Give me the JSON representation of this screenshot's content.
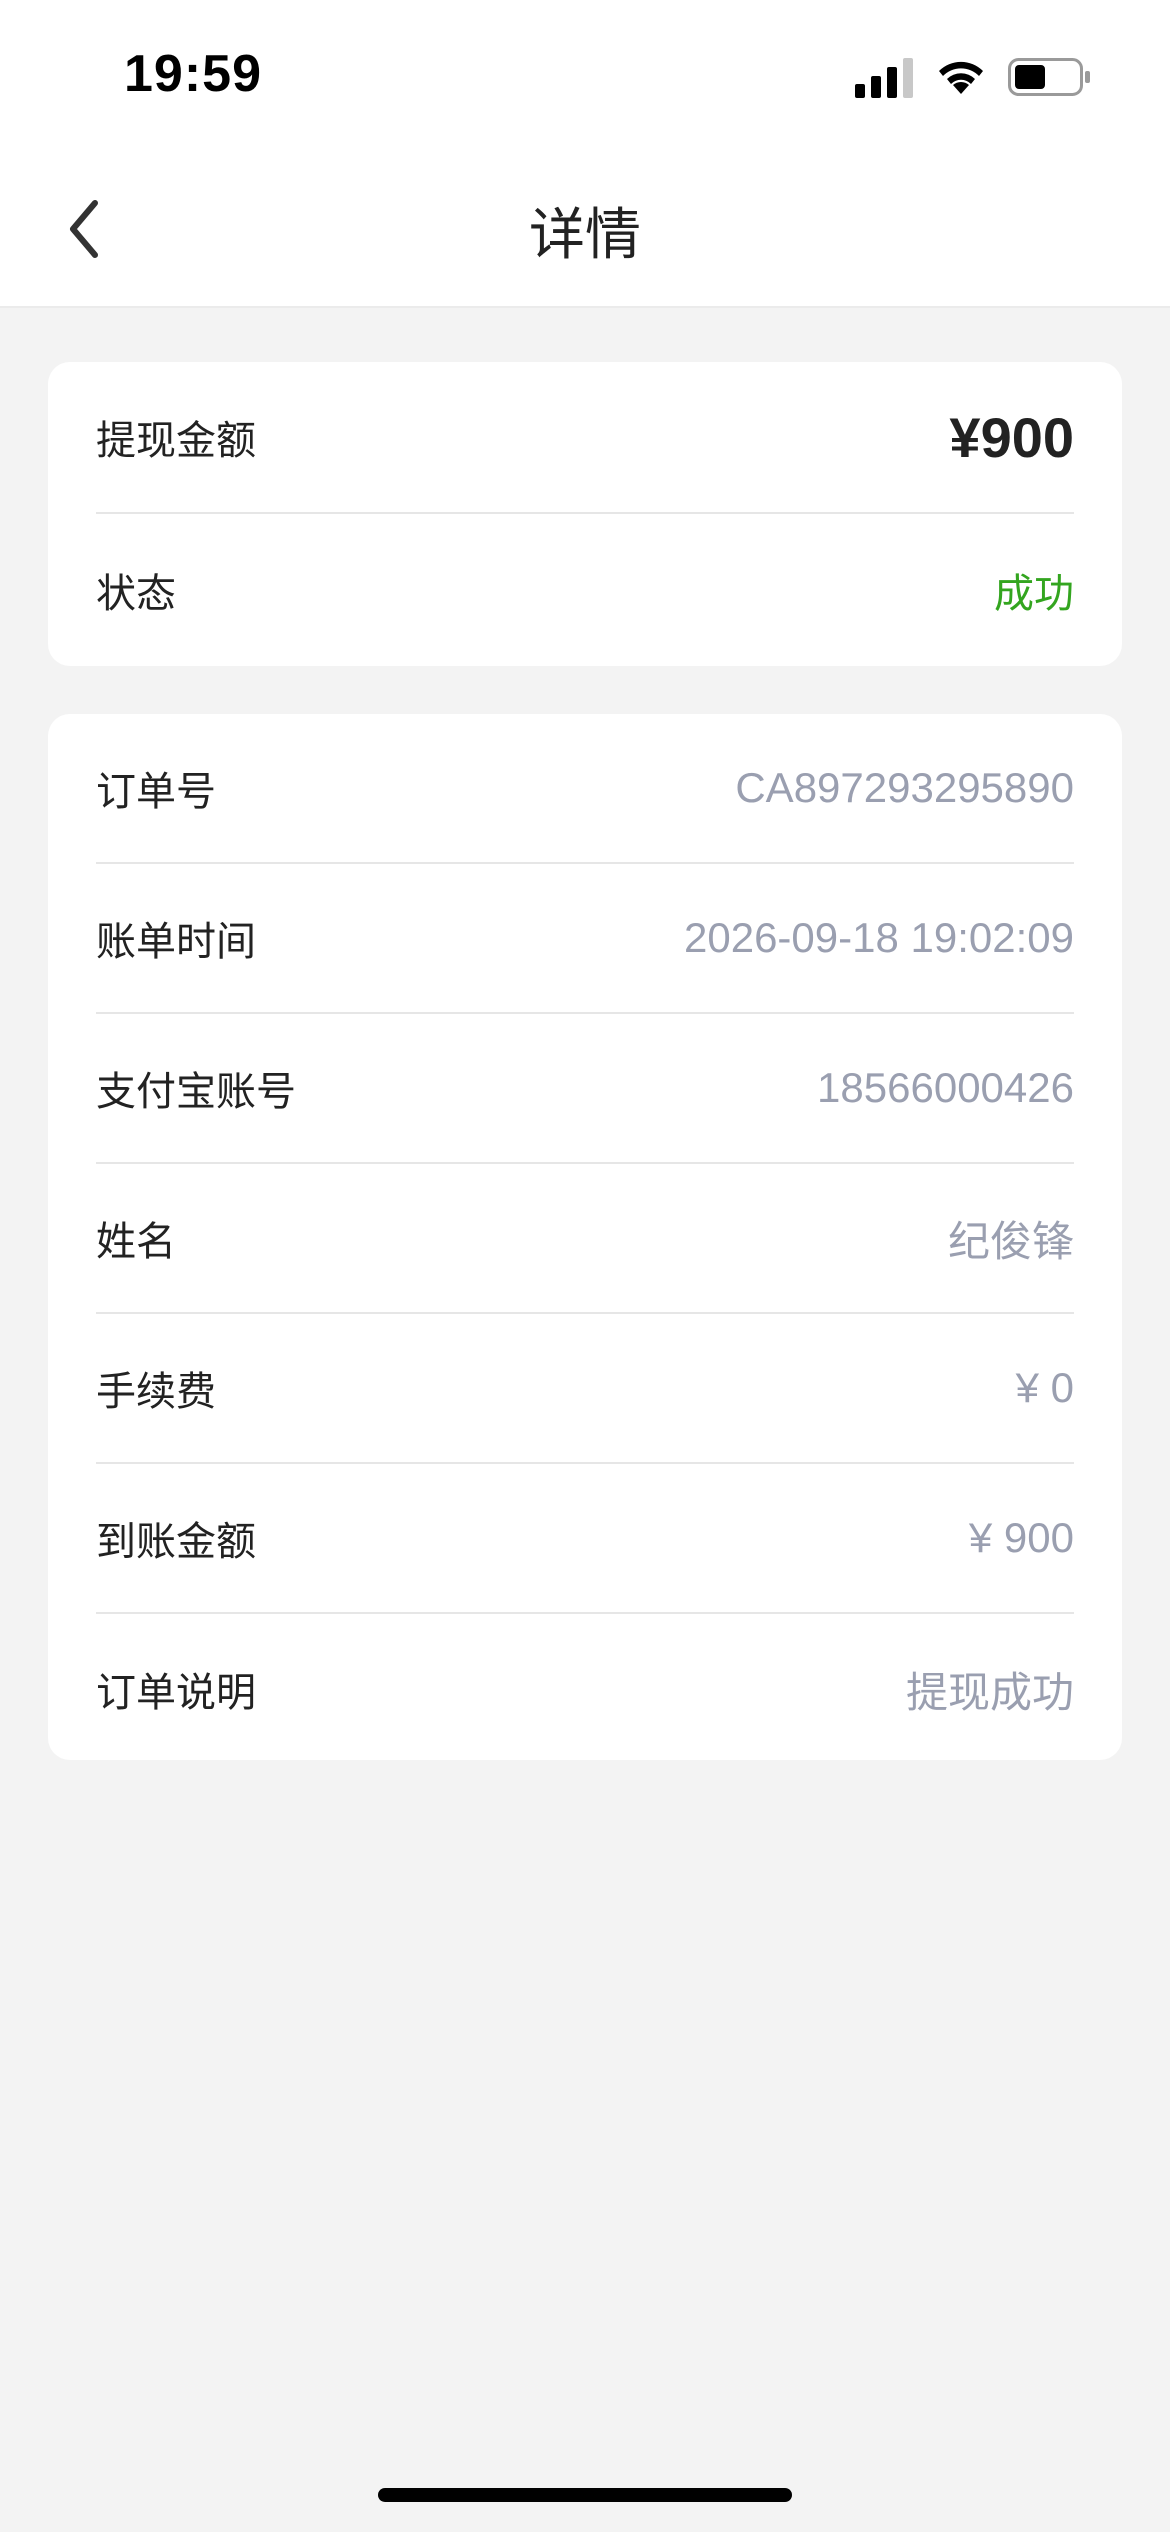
{
  "status_bar": {
    "time": "19:59",
    "icons": [
      "signal-icon",
      "wifi-icon",
      "battery-icon"
    ]
  },
  "nav": {
    "title": "详情",
    "back_icon": "chevron-left-icon"
  },
  "summary": {
    "amount_label": "提现金额",
    "amount_value": "¥900",
    "status_label": "状态",
    "status_value": "成功",
    "status_color": "#33a51f"
  },
  "details": [
    {
      "label": "订单号",
      "value": "CA897293295890"
    },
    {
      "label": "账单时间",
      "value": "2026-09-18 19:02:09"
    },
    {
      "label": "支付宝账号",
      "value": "18566000426"
    },
    {
      "label": "姓名",
      "value": "纪俊锋"
    },
    {
      "label": "手续费",
      "value": "¥ 0"
    },
    {
      "label": "到账金额",
      "value": "¥ 900"
    },
    {
      "label": "订单说明",
      "value": "提现成功"
    }
  ]
}
